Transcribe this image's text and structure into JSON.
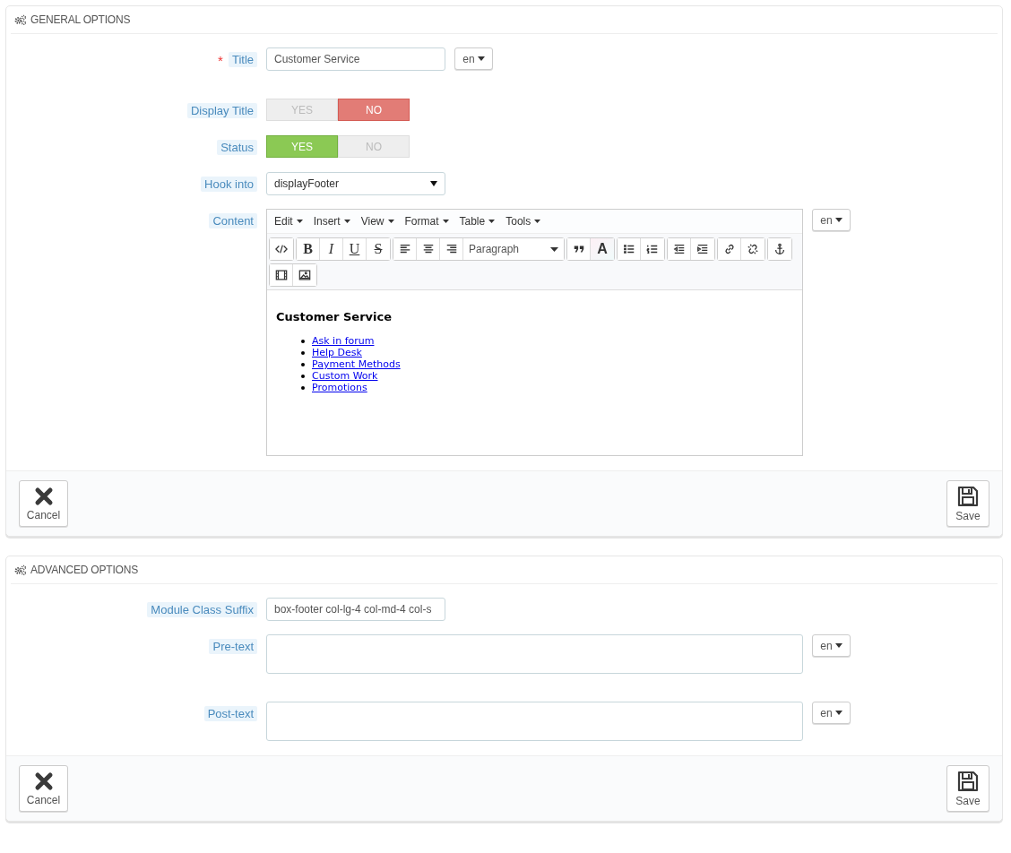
{
  "panels": [
    {
      "title": "GENERAL OPTIONS",
      "fields": [
        {
          "kind": "text",
          "label": "Title",
          "required_mark": "*",
          "value": "Customer Service",
          "lang": "en"
        },
        {
          "kind": "switch",
          "label": "Display Title",
          "options": [
            {
              "label": "YES",
              "kind": "yes",
              "selected": false
            },
            {
              "label": "NO",
              "kind": "no",
              "selected": true
            }
          ]
        },
        {
          "kind": "switch",
          "label": "Status",
          "options": [
            {
              "label": "YES",
              "kind": "yes",
              "selected": true
            },
            {
              "label": "NO",
              "kind": "no",
              "selected": false
            }
          ]
        },
        {
          "kind": "select",
          "label": "Hook into",
          "value": "displayFooter"
        },
        {
          "kind": "editor",
          "label": "Content",
          "lang": "en",
          "menu": [
            "Edit",
            "Insert",
            "View",
            "Format",
            "Table",
            "Tools"
          ],
          "text_buttons": [
            "B",
            "I",
            "U",
            "S"
          ],
          "format": "Paragraph",
          "color_button": "A",
          "heading": "Customer Service",
          "links": [
            "Ask in forum",
            "Help Desk",
            "Payment Methods",
            "Custom Work",
            "Promotions"
          ]
        }
      ],
      "buttons": [
        {
          "kind": "cancel",
          "label": "Cancel"
        },
        {
          "kind": "save",
          "label": "Save"
        }
      ]
    },
    {
      "title": "ADVANCED OPTIONS",
      "fields": [
        {
          "kind": "text",
          "label": "Module Class Suffix",
          "value": "box-footer col-lg-4 col-md-4 col-s"
        },
        {
          "kind": "textarea",
          "label": "Pre-text",
          "lang": "en"
        },
        {
          "kind": "textarea",
          "label": "Post-text",
          "lang": "en"
        }
      ],
      "buttons": [
        {
          "kind": "cancel",
          "label": "Cancel"
        },
        {
          "kind": "save",
          "label": "Save"
        }
      ]
    }
  ]
}
